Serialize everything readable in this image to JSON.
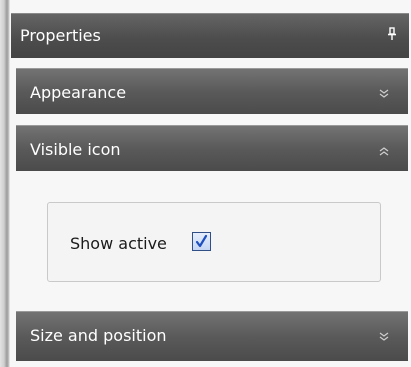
{
  "panel": {
    "title": "Properties",
    "pin_icon": "pin-icon"
  },
  "sections": {
    "appearance": {
      "label": "Appearance",
      "icon": "chevron-down-icon",
      "expanded": false
    },
    "visible_icon": {
      "label": "Visible icon",
      "icon": "chevron-up-icon",
      "expanded": true
    },
    "size_position": {
      "label": "Size and position",
      "icon": "chevron-down-icon",
      "expanded": false
    }
  },
  "visible_icon_options": {
    "show_active_label": "Show active",
    "show_active_checked": true
  },
  "colors": {
    "header": "#4d4d4d",
    "section": "#5a5a5a",
    "checkmark": "#1d4fbf",
    "background": "#f7f7f7"
  }
}
